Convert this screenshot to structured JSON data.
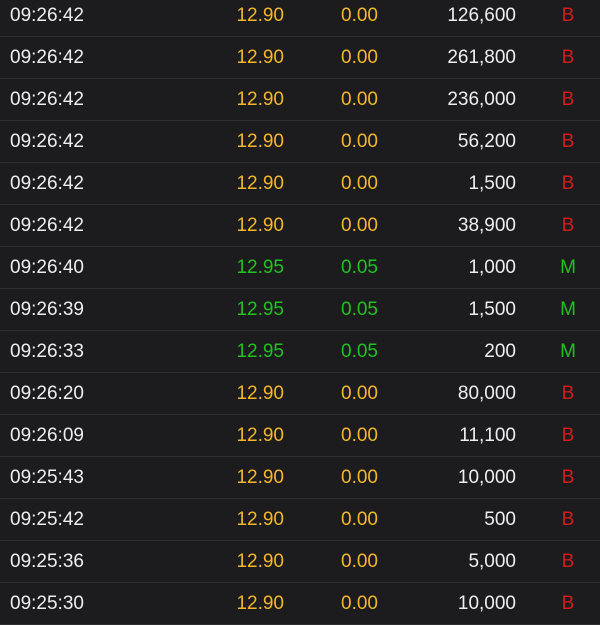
{
  "colors": {
    "background": "#1c1c1e",
    "divider": "#2f2f31",
    "text": "#eeeeee",
    "flat": "#f4b72a",
    "up": "#1fc21f",
    "side_B": "#d21c1c",
    "side_M": "#1fc21f"
  },
  "trades": [
    {
      "time": "09:26:42",
      "price": "12.90",
      "change": "0.00",
      "volume": "126,600",
      "side": "B",
      "trend": "flat"
    },
    {
      "time": "09:26:42",
      "price": "12.90",
      "change": "0.00",
      "volume": "261,800",
      "side": "B",
      "trend": "flat"
    },
    {
      "time": "09:26:42",
      "price": "12.90",
      "change": "0.00",
      "volume": "236,000",
      "side": "B",
      "trend": "flat"
    },
    {
      "time": "09:26:42",
      "price": "12.90",
      "change": "0.00",
      "volume": "56,200",
      "side": "B",
      "trend": "flat"
    },
    {
      "time": "09:26:42",
      "price": "12.90",
      "change": "0.00",
      "volume": "1,500",
      "side": "B",
      "trend": "flat"
    },
    {
      "time": "09:26:42",
      "price": "12.90",
      "change": "0.00",
      "volume": "38,900",
      "side": "B",
      "trend": "flat"
    },
    {
      "time": "09:26:40",
      "price": "12.95",
      "change": "0.05",
      "volume": "1,000",
      "side": "M",
      "trend": "up"
    },
    {
      "time": "09:26:39",
      "price": "12.95",
      "change": "0.05",
      "volume": "1,500",
      "side": "M",
      "trend": "up"
    },
    {
      "time": "09:26:33",
      "price": "12.95",
      "change": "0.05",
      "volume": "200",
      "side": "M",
      "trend": "up"
    },
    {
      "time": "09:26:20",
      "price": "12.90",
      "change": "0.00",
      "volume": "80,000",
      "side": "B",
      "trend": "flat"
    },
    {
      "time": "09:26:09",
      "price": "12.90",
      "change": "0.00",
      "volume": "11,100",
      "side": "B",
      "trend": "flat"
    },
    {
      "time": "09:25:43",
      "price": "12.90",
      "change": "0.00",
      "volume": "10,000",
      "side": "B",
      "trend": "flat"
    },
    {
      "time": "09:25:42",
      "price": "12.90",
      "change": "0.00",
      "volume": "500",
      "side": "B",
      "trend": "flat"
    },
    {
      "time": "09:25:36",
      "price": "12.90",
      "change": "0.00",
      "volume": "5,000",
      "side": "B",
      "trend": "flat"
    },
    {
      "time": "09:25:30",
      "price": "12.90",
      "change": "0.00",
      "volume": "10,000",
      "side": "B",
      "trend": "flat"
    }
  ]
}
